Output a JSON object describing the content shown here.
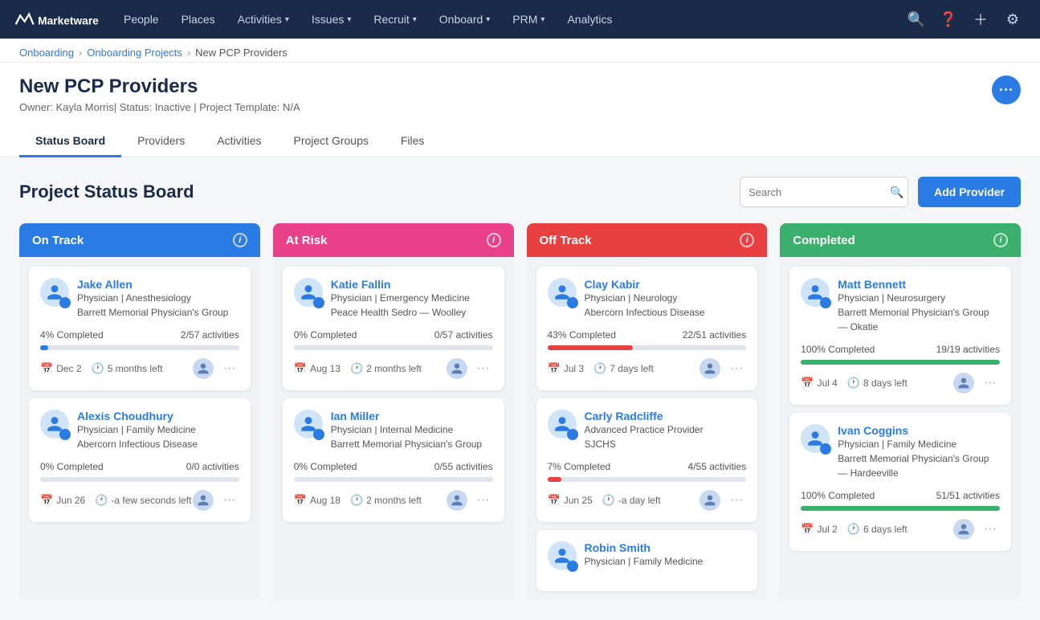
{
  "nav": {
    "logo_text": "Marketware",
    "items": [
      {
        "label": "People",
        "has_caret": false
      },
      {
        "label": "Places",
        "has_caret": false
      },
      {
        "label": "Activities",
        "has_caret": true
      },
      {
        "label": "Issues",
        "has_caret": true
      },
      {
        "label": "Recruit",
        "has_caret": true
      },
      {
        "label": "Onboard",
        "has_caret": true
      },
      {
        "label": "PRM",
        "has_caret": true
      },
      {
        "label": "Analytics",
        "has_caret": false
      }
    ]
  },
  "breadcrumb": {
    "items": [
      "Onboarding",
      "Onboarding Projects",
      "New PCP Providers"
    ]
  },
  "page": {
    "title": "New PCP Providers",
    "subtitle": "Owner: Kayla Morris| Status: Inactive | Project Template: N/A"
  },
  "tabs": [
    {
      "label": "Status Board",
      "active": true
    },
    {
      "label": "Providers"
    },
    {
      "label": "Activities"
    },
    {
      "label": "Project Groups"
    },
    {
      "label": "Files"
    }
  ],
  "board": {
    "title": "Project Status Board",
    "search_placeholder": "Search",
    "add_button": "Add Provider"
  },
  "columns": [
    {
      "title": "On Track",
      "color_class": "col-on-track",
      "fill_class": "fill-blue",
      "cards": [
        {
          "name": "Jake Allen",
          "detail": "Physician | Anesthesiology\nBarrett Memorial Physician's Group",
          "pct": 4,
          "pct_label": "4% Completed",
          "activities": "2/57 activities",
          "date": "Dec 2",
          "time_left": "5 months left"
        },
        {
          "name": "Alexis Choudhury",
          "detail": "Physician | Family Medicine\nAbercorn Infectious Disease",
          "pct": 0,
          "pct_label": "0% Completed",
          "activities": "0/0 activities",
          "date": "Jun 26",
          "time_left": "-a few seconds left"
        }
      ]
    },
    {
      "title": "At Risk",
      "color_class": "col-at-risk",
      "fill_class": "fill-pink",
      "cards": [
        {
          "name": "Katie Fallin",
          "detail": "Physician | Emergency Medicine\nPeace Health Sedro — Woolley",
          "pct": 0,
          "pct_label": "0% Completed",
          "activities": "0/57 activities",
          "date": "Aug 13",
          "time_left": "2 months left"
        },
        {
          "name": "Ian Miller",
          "detail": "Physician | Internal Medicine\nBarrett Memorial Physician's Group",
          "pct": 0,
          "pct_label": "0% Completed",
          "activities": "0/55 activities",
          "date": "Aug 18",
          "time_left": "2 months left"
        }
      ]
    },
    {
      "title": "Off Track",
      "color_class": "col-off-track",
      "fill_class": "fill-red",
      "cards": [
        {
          "name": "Clay Kabir",
          "detail": "Physician | Neurology\nAbercorn Infectious Disease",
          "pct": 43,
          "pct_label": "43% Completed",
          "activities": "22/51 activities",
          "date": "Jul 3",
          "time_left": "7 days left"
        },
        {
          "name": "Carly Radcliffe",
          "detail": "Advanced Practice Provider\nSJCHS",
          "pct": 7,
          "pct_label": "7% Completed",
          "activities": "4/55 activities",
          "date": "Jun 25",
          "time_left": "-a day left"
        },
        {
          "name": "Robin Smith",
          "detail": "Physician | Family Medicine",
          "pct": 0,
          "pct_label": "",
          "activities": "",
          "date": "",
          "time_left": "",
          "partial": true
        }
      ]
    },
    {
      "title": "Completed",
      "color_class": "col-completed",
      "fill_class": "fill-green",
      "cards": [
        {
          "name": "Matt Bennett",
          "detail": "Physician | Neurosurgery\nBarrett Memorial Physician's Group — Okatie",
          "pct": 100,
          "pct_label": "100% Completed",
          "activities": "19/19 activities",
          "date": "Jul 4",
          "time_left": "8 days left"
        },
        {
          "name": "Ivan Coggins",
          "detail": "Physician | Family Medicine\nBarrett Memorial Physician's Group — Hardeeville",
          "pct": 100,
          "pct_label": "100% Completed",
          "activities": "51/51 activities",
          "date": "Jul 2",
          "time_left": "6 days left"
        }
      ]
    }
  ]
}
